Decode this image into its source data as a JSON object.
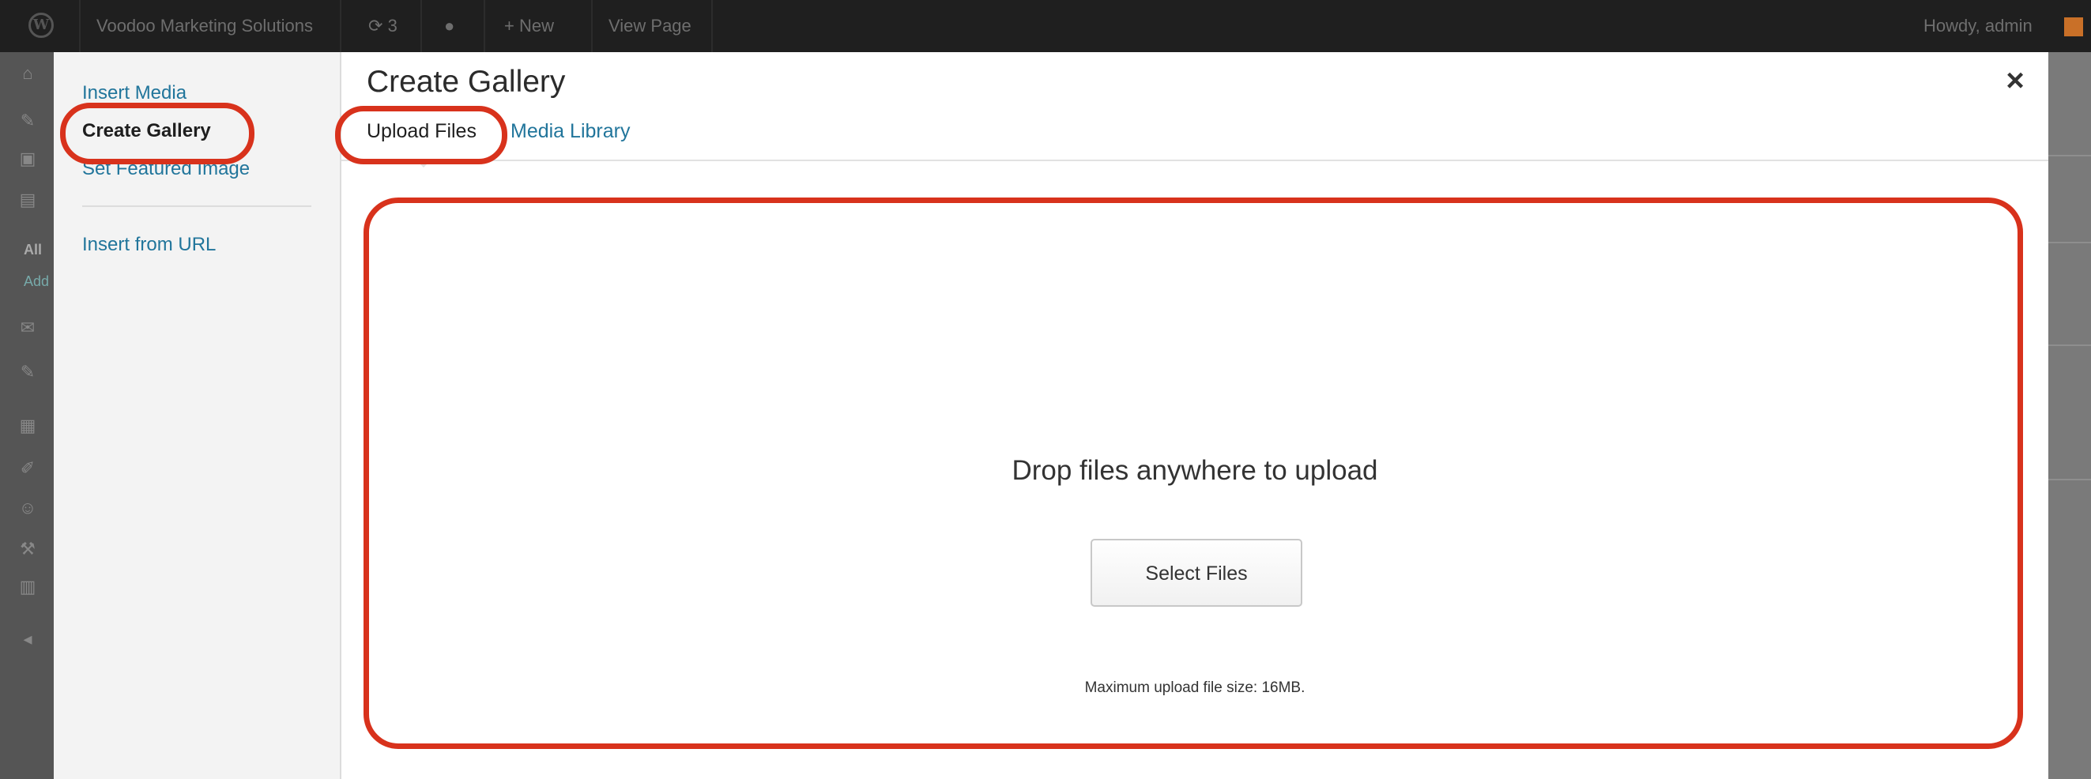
{
  "admin_bar": {
    "site_name": "Voodoo Marketing Solutions",
    "updates_count": "3",
    "new_label": "+ New",
    "view_page_label": "View Page",
    "greeting": "Howdy, admin",
    "colors": {
      "background": "#1f1f1f",
      "text": "#6e6e6e"
    }
  },
  "admin_menu": {
    "visible_labels": [
      "All",
      "Add"
    ]
  },
  "media_modal": {
    "menu": {
      "items": [
        {
          "label": "Insert Media",
          "active": false
        },
        {
          "label": "Create Gallery",
          "active": true
        },
        {
          "label": "Set Featured Image",
          "active": false
        },
        {
          "label": "Insert from URL",
          "active": false
        }
      ]
    },
    "title": "Create Gallery",
    "close_label": "×",
    "tabs": [
      {
        "label": "Upload Files",
        "active": true
      },
      {
        "label": "Media Library",
        "active": false
      }
    ],
    "uploader": {
      "instructions": "Drop files anywhere to upload",
      "button_label": "Select Files",
      "max_size_text": "Maximum upload file size: 16MB."
    }
  },
  "annotations": {
    "highlight_color": "#d8321c",
    "highlighted": [
      "Create Gallery",
      "Upload Files",
      "Drop files anywhere to upload"
    ]
  },
  "colors": {
    "link": "#21759b",
    "overlay": "#6a6a6a"
  }
}
